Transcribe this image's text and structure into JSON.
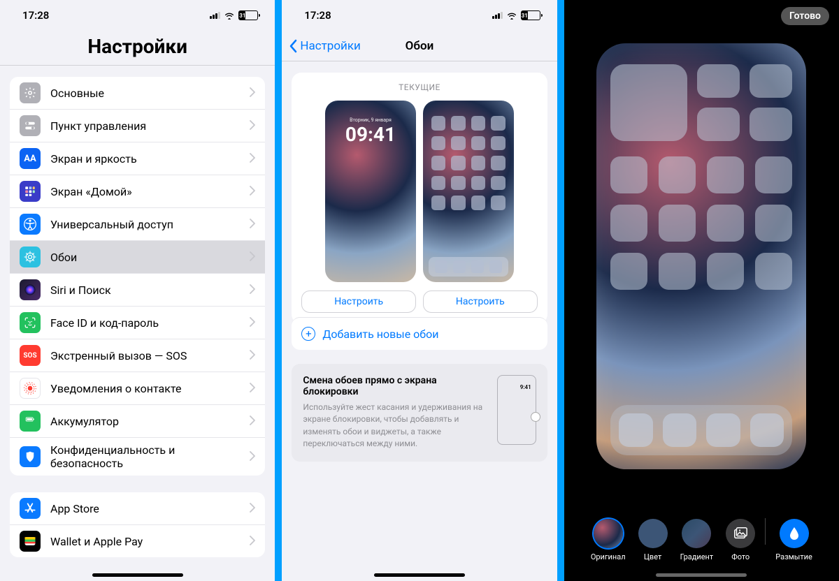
{
  "status": {
    "time": "17:28",
    "battery": "31"
  },
  "panel1": {
    "title": "Настройки",
    "groups": [
      {
        "items": [
          {
            "icon": "gear-icon",
            "bg": "#b0b0b6",
            "label": "Основные"
          },
          {
            "icon": "switches-icon",
            "bg": "#b0b0b6",
            "label": "Пункт управления"
          },
          {
            "icon": "aa-icon",
            "bg": "#0b63f3",
            "label": "Экран и яркость",
            "txt": "AA"
          },
          {
            "icon": "grid-icon",
            "bg": "#3a3cc8",
            "label": "Экран «Домой»"
          },
          {
            "icon": "accessibility-icon",
            "bg": "#0a7aff",
            "label": "Универсальный доступ"
          },
          {
            "icon": "wallpaper-icon",
            "bg": "#2cc1e1",
            "label": "Обои",
            "selected": true
          },
          {
            "icon": "siri-icon",
            "bg": "linear-gradient(135deg,#1a1a2e,#4a2a6a)",
            "label": "Siri и Поиск"
          },
          {
            "icon": "faceid-icon",
            "bg": "#23c15e",
            "label": "Face ID и код-пароль"
          },
          {
            "icon": "sos-icon",
            "bg": "#ff3b30",
            "label": "Экстренный вызов — SOS",
            "txt": "SOS"
          },
          {
            "icon": "exposure-icon",
            "bg": "#ffffff",
            "label": "Уведомления о контакте",
            "fg": "#ff3b30",
            "border": "#e5e5ea"
          },
          {
            "icon": "battery-icon",
            "bg": "#23c15e",
            "label": "Аккумулятор"
          },
          {
            "icon": "privacy-icon",
            "bg": "#0a7aff",
            "label": "Конфиденциальность и безопасность"
          }
        ]
      },
      {
        "items": [
          {
            "icon": "appstore-icon",
            "bg": "#0a7aff",
            "label": "App Store"
          },
          {
            "icon": "wallet-icon",
            "bg": "#000000",
            "label": "Wallet и Apple Pay"
          }
        ]
      }
    ]
  },
  "panel2": {
    "back": "Настройки",
    "title": "Обои",
    "current_label": "ТЕКУЩИЕ",
    "lock_date": "Вторник, 9 января",
    "lock_time": "09:41",
    "configure": "Настроить",
    "add": "Добавить новые обои",
    "tip_title": "Смена обоев прямо с экрана блокировки",
    "tip_body": "Используйте жест касания и удерживания на экране блокировки, чтобы добавлять и изменять обои и виджеты, а также переключаться между ними.",
    "tip_time": "9:41"
  },
  "panel3": {
    "done": "Готово",
    "tools": [
      {
        "id": "original",
        "label": "Оригинал",
        "selected": true
      },
      {
        "id": "color",
        "label": "Цвет"
      },
      {
        "id": "gradient",
        "label": "Градиент"
      },
      {
        "id": "photo",
        "label": "Фото"
      },
      {
        "id": "blur",
        "label": "Размытие",
        "selected": true
      }
    ]
  }
}
